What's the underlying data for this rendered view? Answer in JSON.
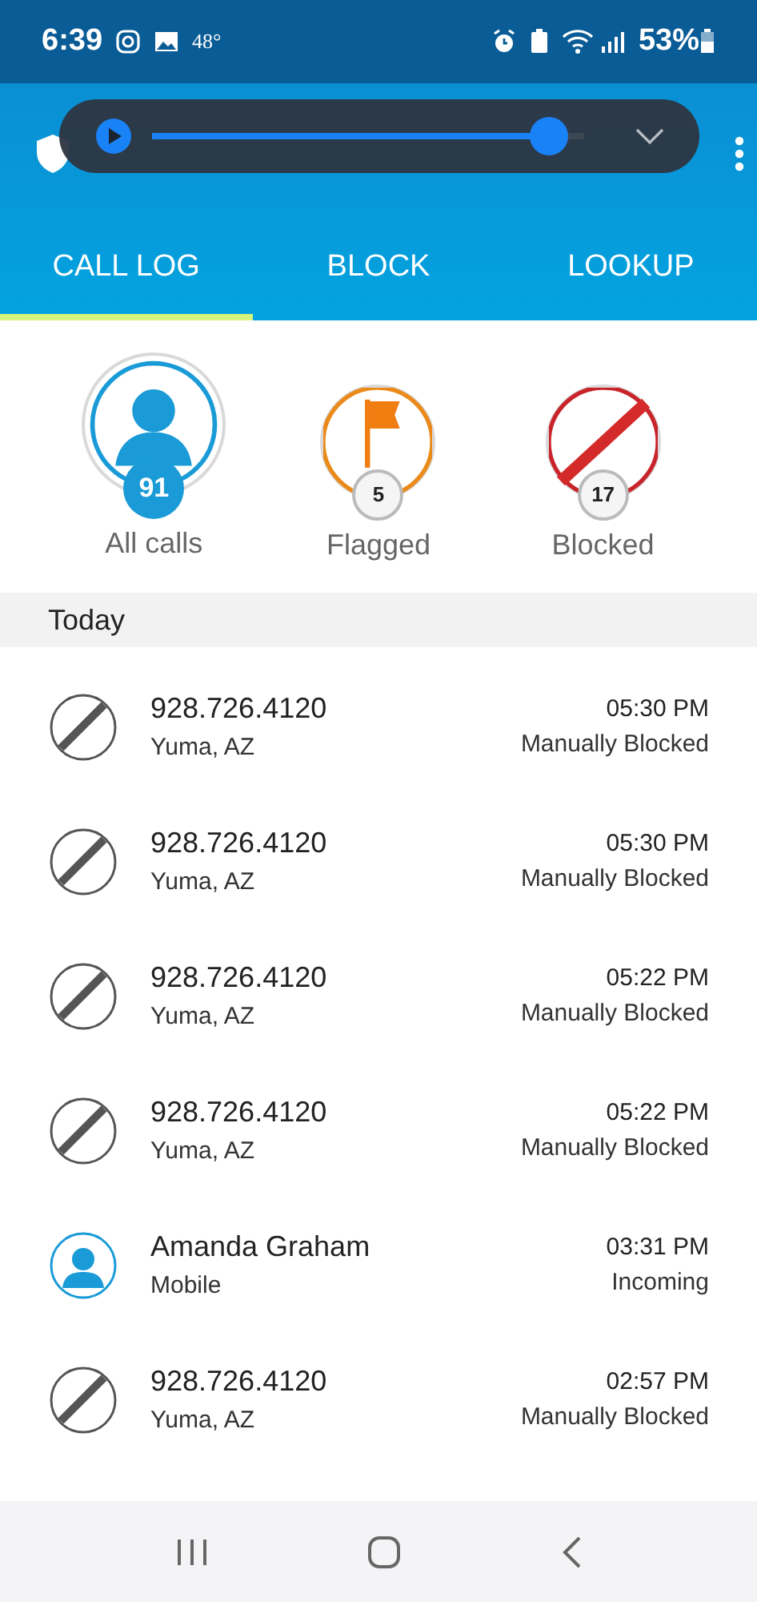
{
  "status_bar": {
    "time": "6:39",
    "temperature": "48°",
    "battery": "53%"
  },
  "media_player": {
    "level": 0.96
  },
  "tabs": [
    {
      "label": "CALL LOG",
      "selected": true
    },
    {
      "label": "BLOCK",
      "selected": false
    },
    {
      "label": "LOOKUP",
      "selected": false
    }
  ],
  "filters": [
    {
      "kind": "all",
      "label": "All calls",
      "count": "91",
      "selected": true
    },
    {
      "kind": "flagged",
      "label": "Flagged",
      "count": "5",
      "selected": false
    },
    {
      "kind": "blocked",
      "label": "Blocked",
      "count": "17",
      "selected": false
    }
  ],
  "section": "Today",
  "calls": [
    {
      "kind": "blocked",
      "name": "928.726.4120",
      "detail": "Yuma, AZ",
      "time": "05:30 PM",
      "status": "Manually Blocked"
    },
    {
      "kind": "blocked",
      "name": "928.726.4120",
      "detail": "Yuma, AZ",
      "time": "05:30 PM",
      "status": "Manually Blocked"
    },
    {
      "kind": "blocked",
      "name": "928.726.4120",
      "detail": "Yuma, AZ",
      "time": "05:22 PM",
      "status": "Manually Blocked"
    },
    {
      "kind": "blocked",
      "name": "928.726.4120",
      "detail": "Yuma, AZ",
      "time": "05:22 PM",
      "status": "Manually Blocked"
    },
    {
      "kind": "contact",
      "name": "Amanda Graham",
      "detail": "Mobile",
      "time": "03:31 PM",
      "status": "Incoming"
    },
    {
      "kind": "blocked",
      "name": "928.726.4120",
      "detail": "Yuma, AZ",
      "time": "02:57 PM",
      "status": "Manually Blocked"
    }
  ]
}
